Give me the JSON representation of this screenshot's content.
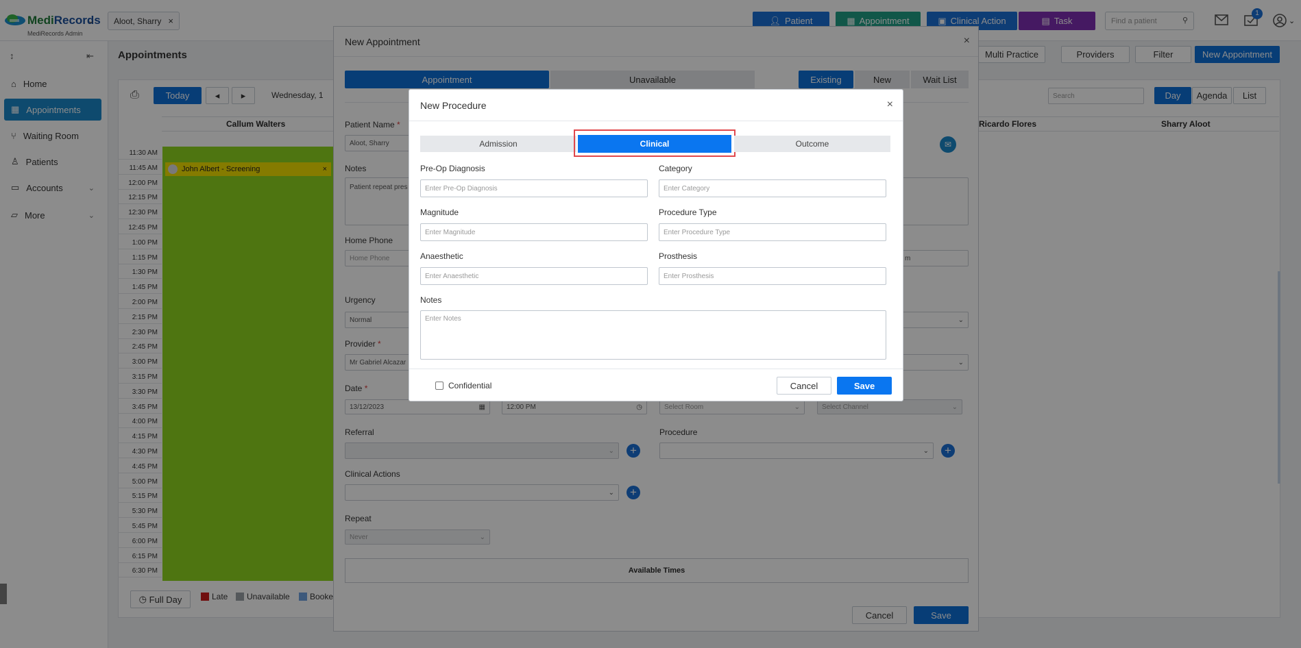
{
  "app": {
    "logo_text_a": "Medi",
    "logo_text_b": "Records",
    "logo_sub": "MediRecords Admin",
    "patient_chip": "Aloot, Sharry",
    "buttons": {
      "patient": "Patient",
      "appointment": "Appointment",
      "clinical_action": "Clinical Action",
      "task": "Task"
    },
    "find_patient_placeholder": "Find a patient",
    "notification_count": "1",
    "colors": {
      "patient": "#1a6fd6",
      "appointment": "#1f9e86",
      "clinical_action": "#1a6fd6",
      "task": "#7e2fb3",
      "accent": "#0d6fd8"
    }
  },
  "sidebar": {
    "items": [
      {
        "label": "Home",
        "icon": "home-icon"
      },
      {
        "label": "Appointments",
        "icon": "calendar-icon"
      },
      {
        "label": "Waiting Room",
        "icon": "chair-icon"
      },
      {
        "label": "Patients",
        "icon": "user-icon"
      },
      {
        "label": "Accounts",
        "icon": "folder-icon"
      },
      {
        "label": "More",
        "icon": "folder-open-icon"
      }
    ]
  },
  "calendar": {
    "title": "Appointments",
    "today": "Today",
    "date_label": "Wednesday, 1",
    "toolbar": {
      "multi_practice": "Multi Practice",
      "providers": "Providers",
      "filter": "Filter",
      "new_appointment": "New Appointment"
    },
    "search_placeholder": "Search",
    "views": [
      "Day",
      "Agenda",
      "List"
    ],
    "columns": [
      "Callum Walters",
      "Ricardo Flores",
      "Sharry Aloot"
    ],
    "times": [
      "11:30 AM",
      "11:45 AM",
      "12:00 PM",
      "12:15 PM",
      "12:30 PM",
      "12:45 PM",
      "1:00 PM",
      "1:15 PM",
      "1:30 PM",
      "1:45 PM",
      "2:00 PM",
      "2:15 PM",
      "2:30 PM",
      "2:45 PM",
      "3:00 PM",
      "3:15 PM",
      "3:30 PM",
      "3:45 PM",
      "4:00 PM",
      "4:15 PM",
      "4:30 PM",
      "4:45 PM",
      "5:00 PM",
      "5:15 PM",
      "5:30 PM",
      "5:45 PM",
      "6:00 PM",
      "6:15 PM",
      "6:30 PM"
    ],
    "appointment": "John Albert - Screening",
    "full_day": "Full Day",
    "legend": [
      {
        "label": "Late",
        "color": "#cc1b1b"
      },
      {
        "label": "Unavailable",
        "color": "#9aa0a6"
      },
      {
        "label": "Booke",
        "color": "#6fa3e0"
      }
    ]
  },
  "appt_modal": {
    "title": "New Appointment",
    "tabs": [
      "Appointment",
      "Unavailable"
    ],
    "mode_tabs": [
      "Existing",
      "New",
      "Wait List"
    ],
    "patient_name_label": "Patient Name",
    "patient_name_value": "Aloot, Sharry",
    "notes_label": "Notes",
    "notes_value": "Patient repeat pres",
    "home_phone_label": "Home Phone",
    "home_phone_placeholder": "Home Phone",
    "right_field_fragment": "m",
    "urgency_label": "Urgency",
    "urgency_value": "Normal",
    "provider_label": "Provider",
    "provider_value": "Mr Gabriel Alcazar",
    "date_label": "Date",
    "date_value": "13/12/2023",
    "time_value": "12:00 PM",
    "room_placeholder": "Select Room",
    "channel_placeholder": "Select Channel",
    "referral_label": "Referral",
    "procedure_label": "Procedure",
    "clinical_actions_label": "Clinical Actions",
    "repeat_label": "Repeat",
    "repeat_value": "Never",
    "available_times": "Available Times",
    "cancel": "Cancel",
    "save": "Save"
  },
  "proc_modal": {
    "title": "New Procedure",
    "tabs": [
      "Admission",
      "Clinical",
      "Outcome"
    ],
    "active_tab": "Clinical",
    "fields": {
      "pre_op": {
        "label": "Pre-Op Diagnosis",
        "placeholder": "Enter Pre-Op Diagnosis"
      },
      "category": {
        "label": "Category",
        "placeholder": "Enter Category"
      },
      "magnitude": {
        "label": "Magnitude",
        "placeholder": "Enter Magnitude"
      },
      "procedure_type": {
        "label": "Procedure Type",
        "placeholder": "Enter Procedure Type"
      },
      "anaesthetic": {
        "label": "Anaesthetic",
        "placeholder": "Enter Anaesthetic"
      },
      "prosthesis": {
        "label": "Prosthesis",
        "placeholder": "Enter Prosthesis"
      },
      "notes": {
        "label": "Notes",
        "placeholder": "Enter Notes"
      }
    },
    "confidential": "Confidential",
    "cancel": "Cancel",
    "save": "Save",
    "highlight_color": "#e0474c"
  }
}
